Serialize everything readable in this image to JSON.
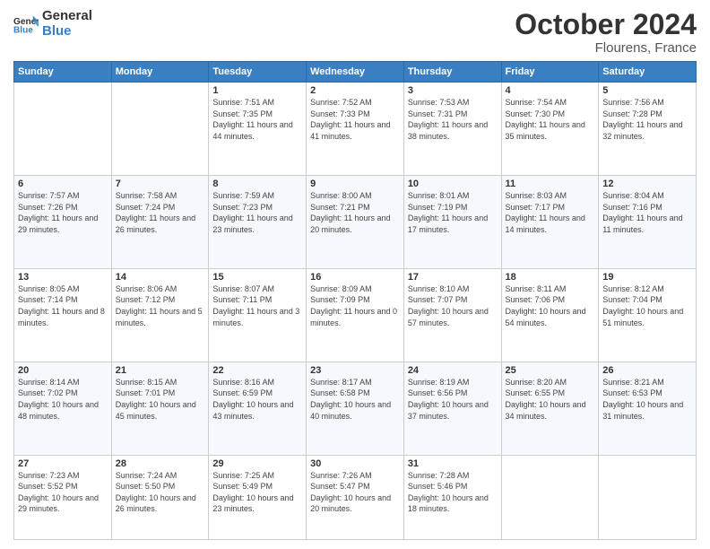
{
  "header": {
    "logo": {
      "general": "General",
      "blue": "Blue"
    },
    "month": "October 2024",
    "location": "Flourens, France"
  },
  "weekdays": [
    "Sunday",
    "Monday",
    "Tuesday",
    "Wednesday",
    "Thursday",
    "Friday",
    "Saturday"
  ],
  "weeks": [
    {
      "days": [
        {
          "number": "",
          "sunrise": "",
          "sunset": "",
          "daylight": "",
          "empty": true
        },
        {
          "number": "",
          "sunrise": "",
          "sunset": "",
          "daylight": "",
          "empty": true
        },
        {
          "number": "1",
          "sunrise": "Sunrise: 7:51 AM",
          "sunset": "Sunset: 7:35 PM",
          "daylight": "Daylight: 11 hours and 44 minutes.",
          "empty": false
        },
        {
          "number": "2",
          "sunrise": "Sunrise: 7:52 AM",
          "sunset": "Sunset: 7:33 PM",
          "daylight": "Daylight: 11 hours and 41 minutes.",
          "empty": false
        },
        {
          "number": "3",
          "sunrise": "Sunrise: 7:53 AM",
          "sunset": "Sunset: 7:31 PM",
          "daylight": "Daylight: 11 hours and 38 minutes.",
          "empty": false
        },
        {
          "number": "4",
          "sunrise": "Sunrise: 7:54 AM",
          "sunset": "Sunset: 7:30 PM",
          "daylight": "Daylight: 11 hours and 35 minutes.",
          "empty": false
        },
        {
          "number": "5",
          "sunrise": "Sunrise: 7:56 AM",
          "sunset": "Sunset: 7:28 PM",
          "daylight": "Daylight: 11 hours and 32 minutes.",
          "empty": false
        }
      ]
    },
    {
      "days": [
        {
          "number": "6",
          "sunrise": "Sunrise: 7:57 AM",
          "sunset": "Sunset: 7:26 PM",
          "daylight": "Daylight: 11 hours and 29 minutes.",
          "empty": false
        },
        {
          "number": "7",
          "sunrise": "Sunrise: 7:58 AM",
          "sunset": "Sunset: 7:24 PM",
          "daylight": "Daylight: 11 hours and 26 minutes.",
          "empty": false
        },
        {
          "number": "8",
          "sunrise": "Sunrise: 7:59 AM",
          "sunset": "Sunset: 7:23 PM",
          "daylight": "Daylight: 11 hours and 23 minutes.",
          "empty": false
        },
        {
          "number": "9",
          "sunrise": "Sunrise: 8:00 AM",
          "sunset": "Sunset: 7:21 PM",
          "daylight": "Daylight: 11 hours and 20 minutes.",
          "empty": false
        },
        {
          "number": "10",
          "sunrise": "Sunrise: 8:01 AM",
          "sunset": "Sunset: 7:19 PM",
          "daylight": "Daylight: 11 hours and 17 minutes.",
          "empty": false
        },
        {
          "number": "11",
          "sunrise": "Sunrise: 8:03 AM",
          "sunset": "Sunset: 7:17 PM",
          "daylight": "Daylight: 11 hours and 14 minutes.",
          "empty": false
        },
        {
          "number": "12",
          "sunrise": "Sunrise: 8:04 AM",
          "sunset": "Sunset: 7:16 PM",
          "daylight": "Daylight: 11 hours and 11 minutes.",
          "empty": false
        }
      ]
    },
    {
      "days": [
        {
          "number": "13",
          "sunrise": "Sunrise: 8:05 AM",
          "sunset": "Sunset: 7:14 PM",
          "daylight": "Daylight: 11 hours and 8 minutes.",
          "empty": false
        },
        {
          "number": "14",
          "sunrise": "Sunrise: 8:06 AM",
          "sunset": "Sunset: 7:12 PM",
          "daylight": "Daylight: 11 hours and 5 minutes.",
          "empty": false
        },
        {
          "number": "15",
          "sunrise": "Sunrise: 8:07 AM",
          "sunset": "Sunset: 7:11 PM",
          "daylight": "Daylight: 11 hours and 3 minutes.",
          "empty": false
        },
        {
          "number": "16",
          "sunrise": "Sunrise: 8:09 AM",
          "sunset": "Sunset: 7:09 PM",
          "daylight": "Daylight: 11 hours and 0 minutes.",
          "empty": false
        },
        {
          "number": "17",
          "sunrise": "Sunrise: 8:10 AM",
          "sunset": "Sunset: 7:07 PM",
          "daylight": "Daylight: 10 hours and 57 minutes.",
          "empty": false
        },
        {
          "number": "18",
          "sunrise": "Sunrise: 8:11 AM",
          "sunset": "Sunset: 7:06 PM",
          "daylight": "Daylight: 10 hours and 54 minutes.",
          "empty": false
        },
        {
          "number": "19",
          "sunrise": "Sunrise: 8:12 AM",
          "sunset": "Sunset: 7:04 PM",
          "daylight": "Daylight: 10 hours and 51 minutes.",
          "empty": false
        }
      ]
    },
    {
      "days": [
        {
          "number": "20",
          "sunrise": "Sunrise: 8:14 AM",
          "sunset": "Sunset: 7:02 PM",
          "daylight": "Daylight: 10 hours and 48 minutes.",
          "empty": false
        },
        {
          "number": "21",
          "sunrise": "Sunrise: 8:15 AM",
          "sunset": "Sunset: 7:01 PM",
          "daylight": "Daylight: 10 hours and 45 minutes.",
          "empty": false
        },
        {
          "number": "22",
          "sunrise": "Sunrise: 8:16 AM",
          "sunset": "Sunset: 6:59 PM",
          "daylight": "Daylight: 10 hours and 43 minutes.",
          "empty": false
        },
        {
          "number": "23",
          "sunrise": "Sunrise: 8:17 AM",
          "sunset": "Sunset: 6:58 PM",
          "daylight": "Daylight: 10 hours and 40 minutes.",
          "empty": false
        },
        {
          "number": "24",
          "sunrise": "Sunrise: 8:19 AM",
          "sunset": "Sunset: 6:56 PM",
          "daylight": "Daylight: 10 hours and 37 minutes.",
          "empty": false
        },
        {
          "number": "25",
          "sunrise": "Sunrise: 8:20 AM",
          "sunset": "Sunset: 6:55 PM",
          "daylight": "Daylight: 10 hours and 34 minutes.",
          "empty": false
        },
        {
          "number": "26",
          "sunrise": "Sunrise: 8:21 AM",
          "sunset": "Sunset: 6:53 PM",
          "daylight": "Daylight: 10 hours and 31 minutes.",
          "empty": false
        }
      ]
    },
    {
      "days": [
        {
          "number": "27",
          "sunrise": "Sunrise: 7:23 AM",
          "sunset": "Sunset: 5:52 PM",
          "daylight": "Daylight: 10 hours and 29 minutes.",
          "empty": false
        },
        {
          "number": "28",
          "sunrise": "Sunrise: 7:24 AM",
          "sunset": "Sunset: 5:50 PM",
          "daylight": "Daylight: 10 hours and 26 minutes.",
          "empty": false
        },
        {
          "number": "29",
          "sunrise": "Sunrise: 7:25 AM",
          "sunset": "Sunset: 5:49 PM",
          "daylight": "Daylight: 10 hours and 23 minutes.",
          "empty": false
        },
        {
          "number": "30",
          "sunrise": "Sunrise: 7:26 AM",
          "sunset": "Sunset: 5:47 PM",
          "daylight": "Daylight: 10 hours and 20 minutes.",
          "empty": false
        },
        {
          "number": "31",
          "sunrise": "Sunrise: 7:28 AM",
          "sunset": "Sunset: 5:46 PM",
          "daylight": "Daylight: 10 hours and 18 minutes.",
          "empty": false
        },
        {
          "number": "",
          "sunrise": "",
          "sunset": "",
          "daylight": "",
          "empty": true
        },
        {
          "number": "",
          "sunrise": "",
          "sunset": "",
          "daylight": "",
          "empty": true
        }
      ]
    }
  ]
}
